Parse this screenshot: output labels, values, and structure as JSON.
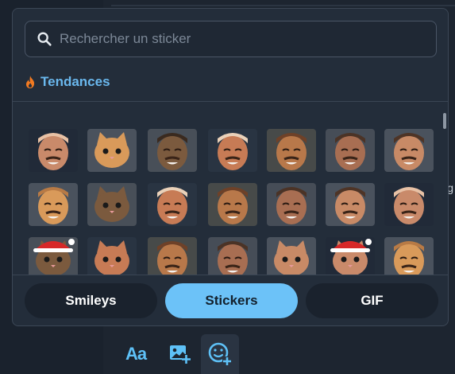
{
  "colors": {
    "accent": "#6cc2f8",
    "panel": "#232d3a",
    "title": "#6ab8ee",
    "flame": "#f27a21"
  },
  "background": {
    "right_fragment": "ig"
  },
  "picker": {
    "search": {
      "placeholder": "Rechercher un sticker",
      "value": "",
      "icon": "search-icon"
    },
    "section": {
      "label": "Tendances",
      "icon": "fire-icon"
    },
    "stickers": [
      "sticker-man-beanie-covering-face",
      "sticker-cat-staring",
      "sticker-man-laughing-vintage",
      "sticker-laughing-man",
      "sticker-man-smiling-closeup",
      "sticker-man-face-closeup",
      "sticker-man-mustache",
      "sticker-man-pointing",
      "sticker-cat-pointing",
      "sticker-man-mustache-costume",
      "sticker-man-hand-on-face",
      "sticker-man-smirk-cigarette",
      "sticker-mask-rabbit-man",
      "sticker-laughing-mustache-man",
      "sticker-cat-santa-hat",
      "sticker-cat-glasses",
      "sticker-creature-face",
      "sticker-man-pointing-finger",
      "sticker-cat-face",
      "sticker-cat-santa-candy",
      "sticker-laughing-man-head"
    ]
  },
  "tabs": [
    {
      "label": "Smileys",
      "active": false
    },
    {
      "label": "Stickers",
      "active": true
    },
    {
      "label": "GIF",
      "active": false
    }
  ],
  "toolbar": {
    "text_format_label": "Aa",
    "image_icon": "image-add-icon",
    "sticker_icon": "sticker-add-icon"
  }
}
